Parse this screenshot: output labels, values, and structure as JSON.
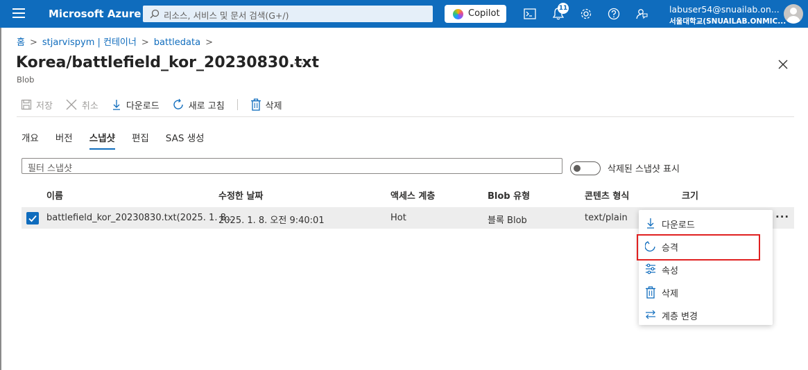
{
  "topbar": {
    "brand": "Microsoft Azure",
    "search_placeholder": "리소스, 서비스 및 문서 검색(G+/)",
    "copilot_label": "Copilot",
    "notification_count": "11",
    "account_email": "labuser54@snuailab.on...",
    "account_tenant": "서울대학교(SNUAILAB.ONMIC..."
  },
  "breadcrumb": {
    "home": "홈",
    "account": "stjarvispym | 컨테이너",
    "container": "battledata"
  },
  "page": {
    "title": "Korea/battlefield_kor_20230830.txt",
    "subtitle": "Blob",
    "more": "···"
  },
  "toolbar": {
    "save": "저장",
    "cancel": "취소",
    "download": "다운로드",
    "refresh": "새로 고침",
    "delete": "삭제"
  },
  "tabs": [
    "개요",
    "버전",
    "스냅샷",
    "편집",
    "SAS 생성"
  ],
  "active_tab": "스냅샷",
  "filter": {
    "placeholder": "필터 스냅샷",
    "toggle_label": "삭제된 스냅샷 표시"
  },
  "table": {
    "columns": [
      "이름",
      "수정한 날짜",
      "액세스 계층",
      "Blob 유형",
      "콘텐츠 형식",
      "크기"
    ],
    "rows": [
      {
        "name": "battlefield_kor_20230830.txt(2025. 1. 8...",
        "modified": "2025. 1. 8. 오전 9:40:01",
        "tier": "Hot",
        "blob_type": "블록 Blob",
        "content_type": "text/plain",
        "size": ""
      }
    ],
    "row_more": "···"
  },
  "context_menu": {
    "items": [
      "다운로드",
      "승격",
      "속성",
      "삭제",
      "계층 변경"
    ],
    "highlighted": "승격"
  },
  "colors": {
    "topbar": "#0f6cbd",
    "accent": "#0f6cbd",
    "highlight_border": "#e02020",
    "row_selected": "#ededed"
  }
}
